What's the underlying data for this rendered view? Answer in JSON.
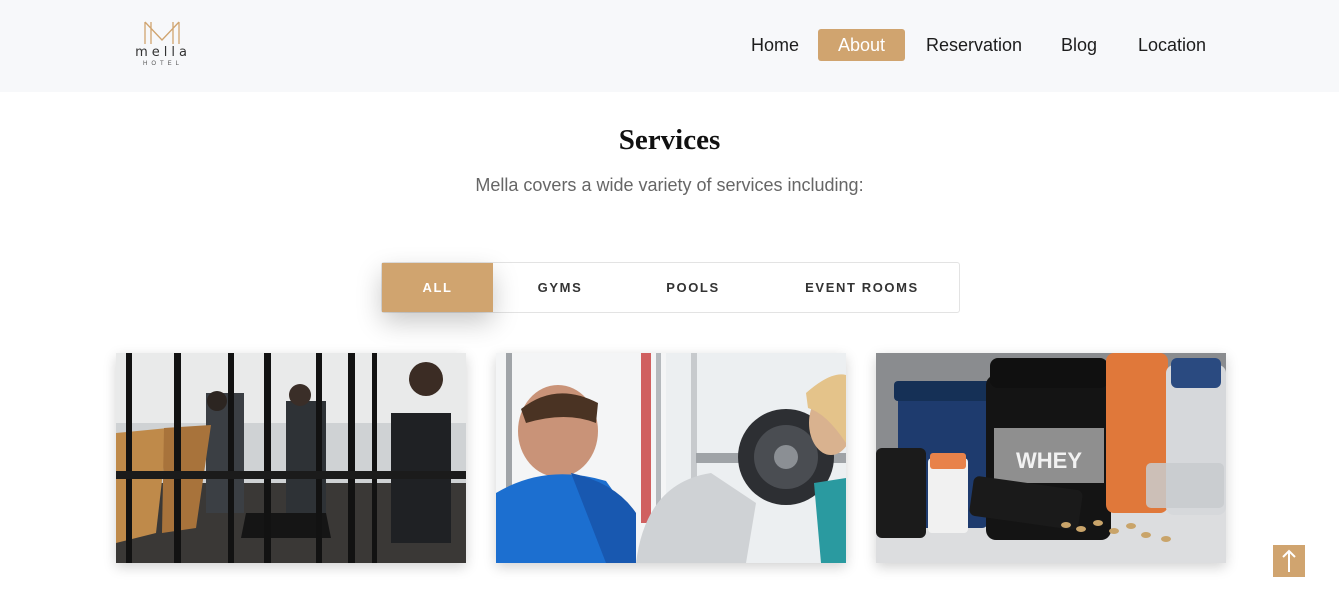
{
  "brand": {
    "name": "mella",
    "tagline": "HOTEL",
    "accent": "#d0a46f"
  },
  "nav": {
    "items": [
      {
        "label": "Home",
        "active": false
      },
      {
        "label": "About",
        "active": true
      },
      {
        "label": "Reservation",
        "active": false
      },
      {
        "label": "Blog",
        "active": false
      },
      {
        "label": "Location",
        "active": false
      }
    ]
  },
  "services": {
    "title": "Services",
    "subtitle": "Mella covers a wide variety of services including:",
    "filters": [
      {
        "label": "ALL",
        "active": true
      },
      {
        "label": "GYMS",
        "active": false
      },
      {
        "label": "POOLS",
        "active": false
      },
      {
        "label": "EVENT ROOMS",
        "active": false
      }
    ]
  },
  "gallery": [
    {
      "subject": "treadmill-room"
    },
    {
      "subject": "trainer-with-barbell"
    },
    {
      "subject": "supplements",
      "label_text": "WHEY"
    }
  ],
  "scroll_top": {
    "icon": "arrow-up-icon"
  }
}
